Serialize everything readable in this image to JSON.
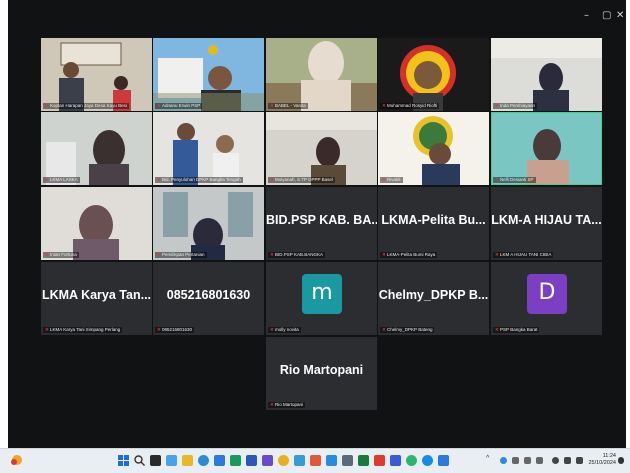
{
  "window": {
    "minimize": "–",
    "restore": "▢",
    "close": "✕"
  },
  "colors": {
    "speaking_border": "#3ecf8e",
    "teal_avatar": "#1a9aa0",
    "purple_avatar": "#7b3fc4",
    "muted_icon": "#e03a3a"
  },
  "tiles": [
    {
      "name": "Koptan Harapan Jaya Desa Kayu Besi"
    },
    {
      "name": "Adnanu Erwin PSP"
    },
    {
      "name": "BABEL - Vanita"
    },
    {
      "name": "Muhammad Rosyid Riofti"
    },
    {
      "name": "Inda Pembiayaan"
    },
    {
      "name": "LKMA LASKA"
    },
    {
      "name": "Bid. Penyuluhan DPKP Bangka Tengah"
    },
    {
      "name": "Mulyanah, S.TP DPPP Basel"
    },
    {
      "name": "Rivaldi"
    },
    {
      "name": "Nelli Desianti SP"
    },
    {
      "name": "Intan Fortuna"
    },
    {
      "name": "Pemilikpan Pertanian"
    },
    {
      "big": "BID.PSP KAB. BA...",
      "name": "BID.PSP KAB.BANGKA"
    },
    {
      "big": "LKMA-Pelita Bu...",
      "name": "LKMA-Pelita Bumi Raya"
    },
    {
      "big": "LKM-A HIJAU TA...",
      "name": "LKM A HIJAU TANI CIBIA"
    },
    {
      "big": "LKMA Karya Tan...",
      "name": "LKMA Karya Tani Simpang Perlang"
    },
    {
      "big": "085216801630",
      "name": "085216801630"
    },
    {
      "avatar": "m",
      "name": "molly novita"
    },
    {
      "big": "Chelmy_DPKP B...",
      "name": "Chelmy_DPKP Bateng"
    },
    {
      "avatar": "D",
      "name": "PSP Bangka Barat"
    },
    {
      "big": "Rio Martopani",
      "name": "Rio Martopani"
    }
  ],
  "taskbar": {
    "tray": "^",
    "time": "11:24",
    "date": "25/10/2024"
  }
}
